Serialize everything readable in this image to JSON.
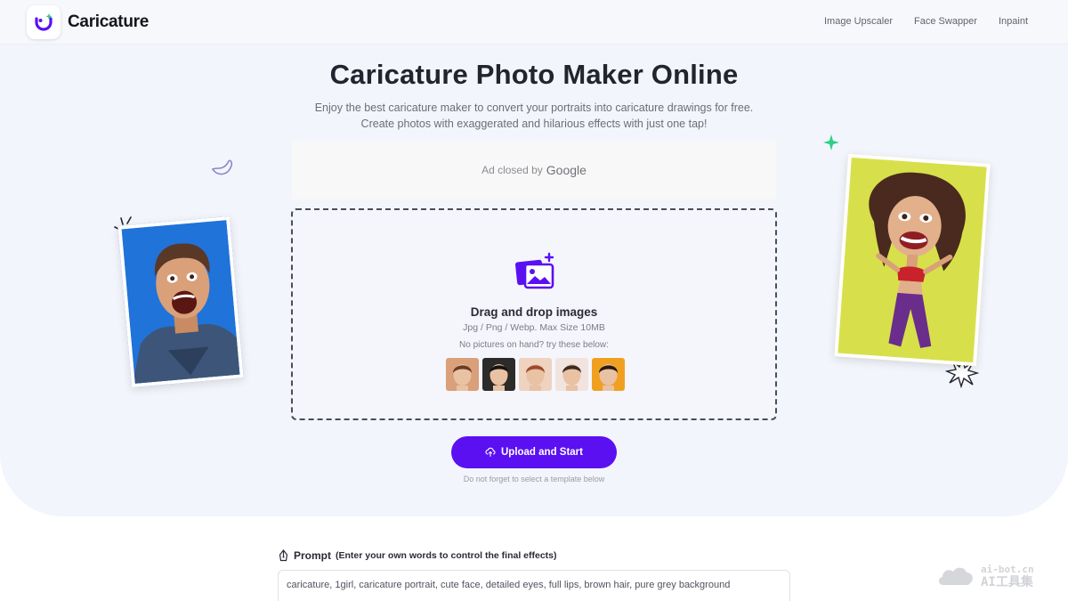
{
  "brand": {
    "name": "Caricature"
  },
  "nav": {
    "items": [
      "Image Upscaler",
      "Face Swapper",
      "Inpaint"
    ]
  },
  "hero": {
    "title": "Caricature Photo Maker Online",
    "subtitle_line1": "Enjoy the best caricature maker to convert your portraits into caricature drawings for free.",
    "subtitle_line2": "Create photos with exaggerated and hilarious effects with just one tap!"
  },
  "ad": {
    "text": "Ad closed by",
    "brand": "Google"
  },
  "upload": {
    "title": "Drag and drop images",
    "formats": "Jpg / Png / Webp. Max Size 10MB",
    "try_text": "No pictures on hand? try these below:",
    "button_label": "Upload and Start",
    "note": "Do not forget to select a template below"
  },
  "samples": [
    {
      "icon": "sample-face-1",
      "bg": "#d9a07a",
      "hair": "#6b3b22"
    },
    {
      "icon": "sample-face-2",
      "bg": "#2d2a2a",
      "hair": "#151212"
    },
    {
      "icon": "sample-face-3",
      "bg": "#efd2c0",
      "hair": "#9a4a2a"
    },
    {
      "icon": "sample-face-4",
      "bg": "#f1e4de",
      "hair": "#3a2a24"
    },
    {
      "icon": "sample-face-5",
      "bg": "#f0a020",
      "hair": "#2a1a10"
    }
  ],
  "prompt": {
    "label": "Prompt",
    "sublabel": "(Enter your own words to control the final effects)",
    "value": "caricature, 1girl, caricature portrait, cute face, detailed eyes, full lips, brown hair, pure grey background"
  },
  "watermark": {
    "line1": "ai-bot.cn",
    "line2": "AI工具集"
  },
  "colors": {
    "accent": "#5b10f2",
    "hero_bg": "#f3f5fc",
    "left_photo_bg": "#1f73d9",
    "right_photo_bg": "#d7e04a",
    "sparkle": "#2ecf8a"
  }
}
